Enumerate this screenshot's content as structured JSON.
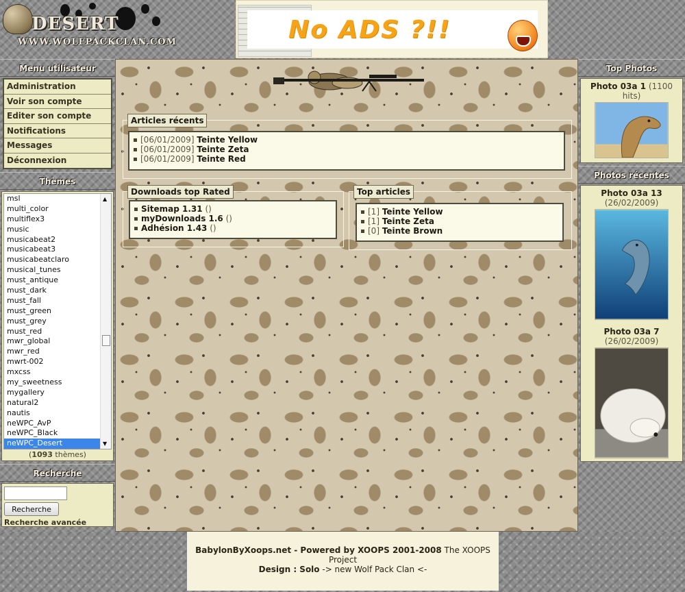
{
  "header": {
    "logo_title": "DESERT",
    "logo_url": "WWW.WOLFPACKCLAN.COM",
    "ad_text": "No ADS ?!!"
  },
  "user_menu": {
    "title": "Menu utilisateur",
    "items": [
      {
        "label": "Administration"
      },
      {
        "label": "Voir son compte"
      },
      {
        "label": "Editer son compte"
      },
      {
        "label": "Notifications"
      },
      {
        "label": "Messages"
      },
      {
        "label": "Déconnexion"
      }
    ]
  },
  "themes": {
    "title": "Thèmes",
    "options": [
      "msl",
      "multi_color",
      "multiflex3",
      "music",
      "musicabeat2",
      "musicabeat3",
      "musicabeatclaro",
      "musical_tunes",
      "must_antique",
      "must_dark",
      "must_fall",
      "must_green",
      "must_grey",
      "must_red",
      "mwr_global",
      "mwr_red",
      "mwrt-002",
      "mxcss",
      "my_sweetness",
      "mygallery",
      "natural2",
      "nautis",
      "neWPC_AvP",
      "neWPC_Black",
      "neWPC_Desert"
    ],
    "selected": "neWPC_Desert",
    "count_prefix": "(",
    "count": "1093",
    "count_suffix": " thèmes)"
  },
  "search": {
    "title": "Recherche",
    "input_value": "",
    "button_label": "Recherche",
    "advanced_label": "Recherche avancée"
  },
  "recent_articles": {
    "title": "Articles récents",
    "items": [
      {
        "date": "[06/01/2009]",
        "title": "Teinte Yellow"
      },
      {
        "date": "[06/01/2009]",
        "title": "Teinte Zeta"
      },
      {
        "date": "[06/01/2009]",
        "title": "Teinte Red"
      }
    ]
  },
  "downloads_top_rated": {
    "title": "Downloads top Rated",
    "items": [
      {
        "title": "Sitemap 1.31",
        "paren": "()"
      },
      {
        "title": "myDownloads 1.6",
        "paren": "()"
      },
      {
        "title": "Adhésion 1.43",
        "paren": "()"
      }
    ]
  },
  "top_articles": {
    "title": "Top articles",
    "items": [
      {
        "rank": "[1]",
        "title": "Teinte Yellow"
      },
      {
        "rank": "[1]",
        "title": "Teinte Zeta"
      },
      {
        "rank": "[0]",
        "title": "Teinte Brown"
      }
    ]
  },
  "top_photos": {
    "title": "Top Photos",
    "items": [
      {
        "name": "Photo 03a 1",
        "meta": "(1100 hits)",
        "icon": "camel-photo"
      }
    ]
  },
  "recent_photos": {
    "title": "Photos récentes",
    "items": [
      {
        "name": "Photo 03a 13",
        "meta": "(26/02/2009)",
        "icon": "dolphin-photo"
      },
      {
        "name": "Photo 03a 7",
        "meta": "(26/02/2009)",
        "icon": "polar-bear-photo"
      }
    ]
  },
  "footer": {
    "line1_bold": "BabylonByXoops.net - Powered by XOOPS 2001-2008",
    "line1_normal": " The XOOPS Project",
    "line2_bold": "Design : Solo",
    "line2_normal": " -> new Wolf Pack Clan <-"
  }
}
